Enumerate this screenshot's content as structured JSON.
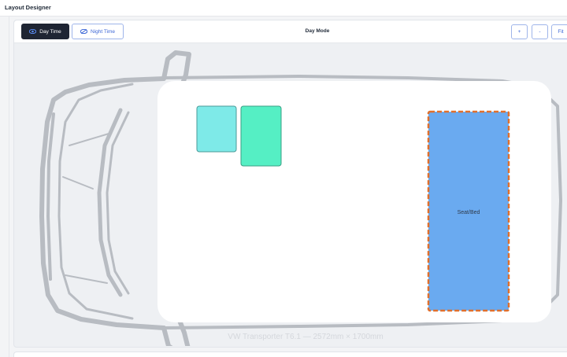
{
  "app": {
    "title": "Layout Designer"
  },
  "toolbar": {
    "day_label": "Day Time",
    "night_label": "Night Time",
    "mode_label": "Day Mode",
    "zoom_in_label": "+",
    "zoom_out_label": "-",
    "fit_label": "Fit"
  },
  "canvas": {
    "vehicle_label": "VW Transporter T6.1 — 2572mm × 1700mm",
    "items": [
      {
        "label": "",
        "color": "#7eeae8"
      },
      {
        "label": "",
        "color": "#55efc4"
      },
      {
        "label": "Seat/Bed",
        "color": "#6aaaf0",
        "selected_outline": "#e0702d"
      }
    ]
  },
  "colors": {
    "accent": "#3b66d6",
    "dark": "#1f2533",
    "van_outline": "#b8bcc2"
  }
}
